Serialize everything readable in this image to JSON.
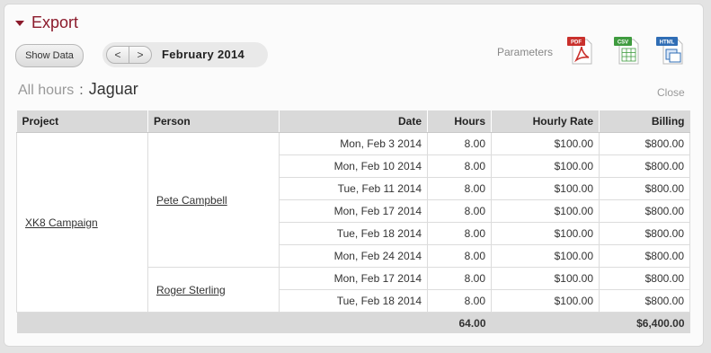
{
  "header": {
    "title": "Export"
  },
  "toolbar": {
    "show_data_label": "Show Data",
    "prev_label": "<",
    "next_label": ">",
    "month": "February 2014",
    "parameters_label": "Parameters",
    "export_icons": [
      {
        "name": "pdf-export-icon",
        "label": "PDF"
      },
      {
        "name": "csv-export-icon",
        "label": "CSV"
      },
      {
        "name": "html-export-icon",
        "label": "HTML"
      }
    ]
  },
  "breadcrumb": {
    "all": "All hours",
    "separator": ":",
    "current": "Jaguar"
  },
  "close_label": "Close",
  "table": {
    "columns": [
      "Project",
      "Person",
      "Date",
      "Hours",
      "Hourly Rate",
      "Billing"
    ],
    "project": "XK8 Campaign",
    "people": [
      {
        "name": "Pete Campbell",
        "rows": [
          {
            "date": "Mon, Feb 3 2014",
            "hours": "8.00",
            "rate": "$100.00",
            "billing": "$800.00"
          },
          {
            "date": "Mon, Feb 10 2014",
            "hours": "8.00",
            "rate": "$100.00",
            "billing": "$800.00"
          },
          {
            "date": "Tue, Feb 11 2014",
            "hours": "8.00",
            "rate": "$100.00",
            "billing": "$800.00"
          },
          {
            "date": "Mon, Feb 17 2014",
            "hours": "8.00",
            "rate": "$100.00",
            "billing": "$800.00"
          },
          {
            "date": "Tue, Feb 18 2014",
            "hours": "8.00",
            "rate": "$100.00",
            "billing": "$800.00"
          },
          {
            "date": "Mon, Feb 24 2014",
            "hours": "8.00",
            "rate": "$100.00",
            "billing": "$800.00"
          }
        ]
      },
      {
        "name": "Roger Sterling",
        "rows": [
          {
            "date": "Mon, Feb 17 2014",
            "hours": "8.00",
            "rate": "$100.00",
            "billing": "$800.00"
          },
          {
            "date": "Tue, Feb 18 2014",
            "hours": "8.00",
            "rate": "$100.00",
            "billing": "$800.00"
          }
        ]
      }
    ],
    "totals": {
      "hours": "64.00",
      "billing": "$6,400.00"
    }
  },
  "colors": {
    "accent": "#8b1a2b",
    "pdf": "#c9302c",
    "csv": "#3f9b3f",
    "html": "#2f6db5"
  }
}
